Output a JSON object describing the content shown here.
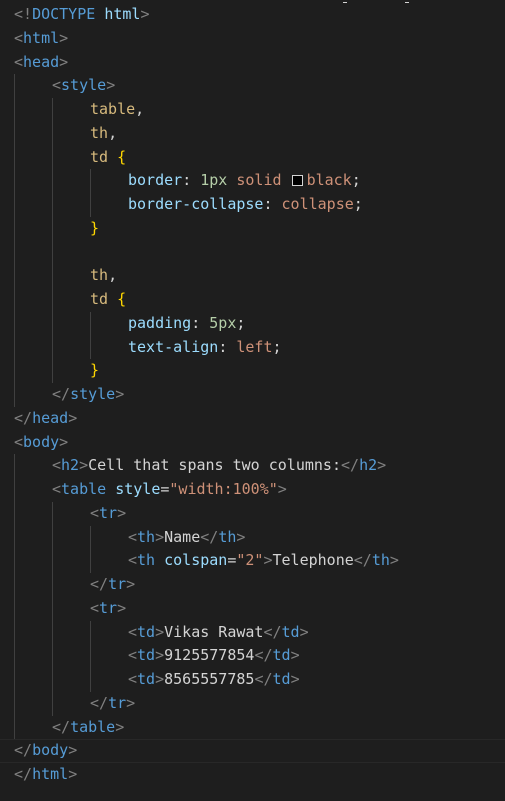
{
  "editor": {
    "language": "html",
    "theme_colors": {
      "background": "#1e1e1e",
      "tag": "#569cd6",
      "bracket": "#808080",
      "attribute": "#9cdcfe",
      "string": "#ce9178",
      "selector": "#d7ba7d",
      "brace": "#ffd700",
      "number": "#b5cea8",
      "text": "#d4d4d4"
    },
    "lines": {
      "l1": {
        "lt": "<!",
        "doctype": "DOCTYPE",
        "sp": " ",
        "name": "html",
        "gt": ">"
      },
      "l2": {
        "lt": "<",
        "tag": "html",
        "gt": ">"
      },
      "l3": {
        "lt": "<",
        "tag": "head",
        "gt": ">"
      },
      "l4": {
        "lt": "<",
        "tag": "style",
        "gt": ">"
      },
      "l5": {
        "sel": "table",
        "comma": ","
      },
      "l6": {
        "sel": "th",
        "comma": ","
      },
      "l7": {
        "sel": "td",
        "sp": " ",
        "brace": "{"
      },
      "l8": {
        "prop": "border",
        "colon": ": ",
        "num": "1px",
        "sp1": " ",
        "val1": "solid",
        "sp2": " ",
        "val2": "black",
        "semi": ";",
        "swatch_color": "#000000"
      },
      "l9": {
        "prop": "border-collapse",
        "colon": ": ",
        "val": "collapse",
        "semi": ";"
      },
      "l10": {
        "brace": "}"
      },
      "l11": {
        "text": ""
      },
      "l12": {
        "sel": "th",
        "comma": ","
      },
      "l13": {
        "sel": "td",
        "sp": " ",
        "brace": "{"
      },
      "l14": {
        "prop": "padding",
        "colon": ": ",
        "num": "5px",
        "semi": ";"
      },
      "l15": {
        "prop": "text-align",
        "colon": ": ",
        "val": "left",
        "semi": ";"
      },
      "l16": {
        "brace": "}"
      },
      "l17": {
        "lt": "</",
        "tag": "style",
        "gt": ">"
      },
      "l18": {
        "lt": "</",
        "tag": "head",
        "gt": ">"
      },
      "l19": {
        "lt": "<",
        "tag": "body",
        "gt": ">"
      },
      "l20": {
        "lt": "<",
        "tag": "h2",
        "gt": ">",
        "text": "Cell that spans two columns:",
        "lt2": "</",
        "tag2": "h2",
        "gt2": ">"
      },
      "l21": {
        "lt": "<",
        "tag": "table",
        "sp": " ",
        "attr": "style",
        "eq": "=",
        "str": "\"width:100%\"",
        "gt": ">"
      },
      "l22": {
        "lt": "<",
        "tag": "tr",
        "gt": ">"
      },
      "l23": {
        "lt": "<",
        "tag": "th",
        "gt": ">",
        "text": "Name",
        "lt2": "</",
        "tag2": "th",
        "gt2": ">"
      },
      "l24": {
        "lt": "<",
        "tag": "th",
        "sp": " ",
        "attr": "colspan",
        "eq": "=",
        "str": "\"2\"",
        "gt": ">",
        "text": "Telephone",
        "lt2": "</",
        "tag2": "th",
        "gt2": ">"
      },
      "l25": {
        "lt": "</",
        "tag": "tr",
        "gt": ">"
      },
      "l26": {
        "lt": "<",
        "tag": "tr",
        "gt": ">"
      },
      "l27": {
        "lt": "<",
        "tag": "td",
        "gt": ">",
        "text": "Vikas Rawat",
        "lt2": "</",
        "tag2": "td",
        "gt2": ">"
      },
      "l28": {
        "lt": "<",
        "tag": "td",
        "gt": ">",
        "text": "9125577854",
        "lt2": "</",
        "tag2": "td",
        "gt2": ">"
      },
      "l29": {
        "lt": "<",
        "tag": "td",
        "gt": ">",
        "text": "8565557785",
        "lt2": "</",
        "tag2": "td",
        "gt2": ">"
      },
      "l30": {
        "lt": "</",
        "tag": "tr",
        "gt": ">"
      },
      "l31": {
        "lt": "</",
        "tag": "table",
        "gt": ">"
      },
      "l32": {
        "lt": "</",
        "tag": "body",
        "gt": ">"
      },
      "l33": {
        "lt": "</",
        "tag": "html",
        "gt": ">"
      }
    }
  }
}
